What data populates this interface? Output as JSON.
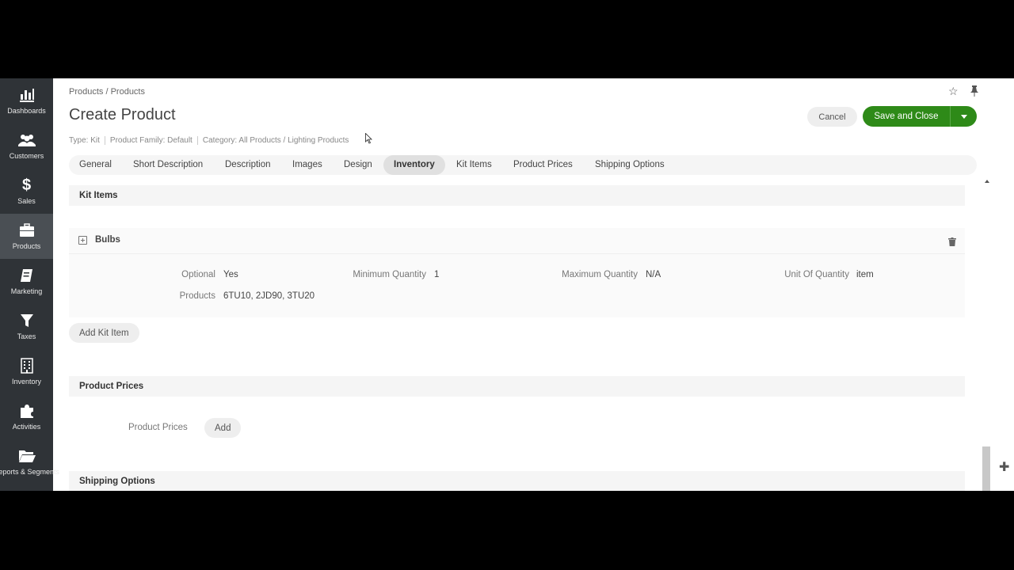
{
  "sidebar": {
    "items": [
      {
        "label": "Dashboards",
        "icon": "dashboards-icon"
      },
      {
        "label": "Customers",
        "icon": "customers-icon"
      },
      {
        "label": "Sales",
        "icon": "dollar-icon"
      },
      {
        "label": "Products",
        "icon": "briefcase-icon"
      },
      {
        "label": "Marketing",
        "icon": "marketing-icon"
      },
      {
        "label": "Taxes",
        "icon": "funnel-icon"
      },
      {
        "label": "Inventory",
        "icon": "building-icon"
      },
      {
        "label": "Activities",
        "icon": "puzzle-icon"
      },
      {
        "label": "Reports & Segments",
        "icon": "folder-icon"
      }
    ],
    "active": "Products"
  },
  "header": {
    "breadcrumb": "Products / Products",
    "title": "Create Product",
    "meta": {
      "type": "Type: Kit",
      "family": "Product Family: Default",
      "category": "Category: All Products / Lighting Products"
    },
    "cancel_label": "Cancel",
    "save_label": "Save and Close"
  },
  "tabs": [
    {
      "label": "General"
    },
    {
      "label": "Short Description"
    },
    {
      "label": "Description"
    },
    {
      "label": "Images"
    },
    {
      "label": "Design"
    },
    {
      "label": "Inventory"
    },
    {
      "label": "Kit Items"
    },
    {
      "label": "Product Prices"
    },
    {
      "label": "Shipping Options"
    }
  ],
  "active_tab": "Inventory",
  "kit_items": {
    "section_title": "Kit Items",
    "item": {
      "name": "Bulbs",
      "optional_label": "Optional",
      "optional_value": "Yes",
      "min_label": "Minimum Quantity",
      "min_value": "1",
      "max_label": "Maximum Quantity",
      "max_value": "N/A",
      "unit_label": "Unit Of Quantity",
      "unit_value": "item",
      "products_label": "Products",
      "products_value": "6TU10, 2JD90, 3TU20"
    },
    "add_label": "Add Kit Item"
  },
  "product_prices": {
    "section_title": "Product Prices",
    "field_label": "Product Prices",
    "add_label": "Add"
  },
  "shipping_options": {
    "section_title": "Shipping Options"
  },
  "colors": {
    "sidebar_bg": "#2f3337",
    "primary_green": "#2e8a18"
  }
}
